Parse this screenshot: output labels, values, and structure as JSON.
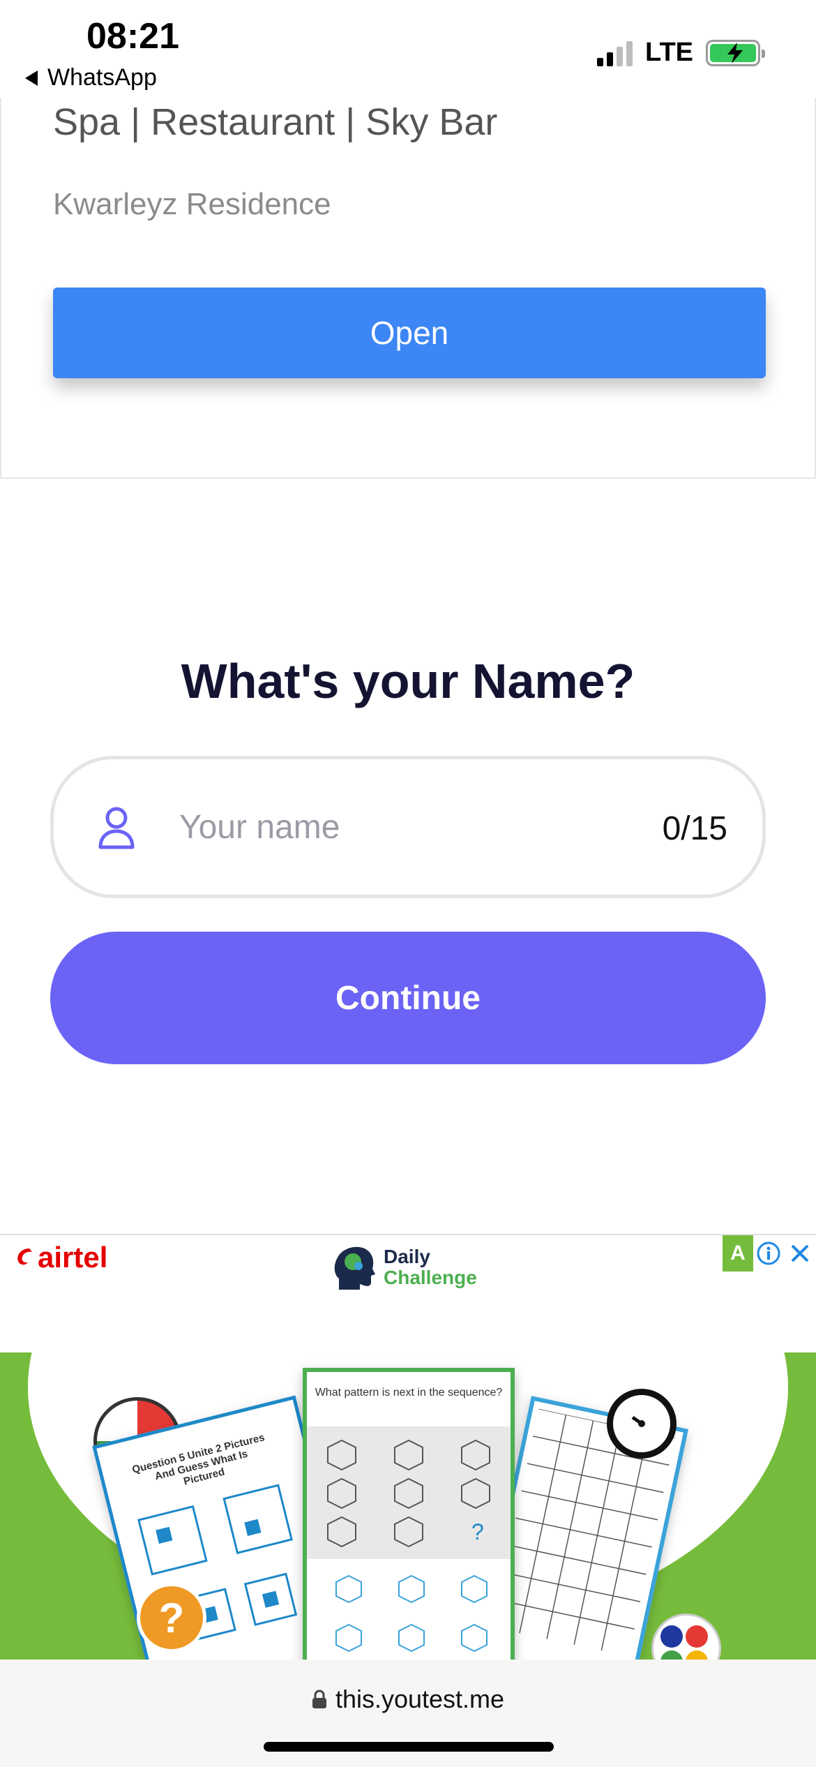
{
  "status_bar": {
    "time": "08:21",
    "back_app": "WhatsApp",
    "network": "LTE"
  },
  "top_card": {
    "title": "Spa | Restaurant | Sky Bar",
    "subtitle": "Kwarleyz Residence",
    "open_label": "Open"
  },
  "name_form": {
    "heading": "What's your Name?",
    "input_value": "",
    "input_placeholder": "Your name",
    "counter": "0/15",
    "continue_label": "Continue"
  },
  "ad": {
    "brand": "airtel",
    "headline_line1": "Daily",
    "headline_line2": "Challenge",
    "badge_letter": "A",
    "sheet_left_title": "Question 5 Unite 2 Pictures And Guess What Is Pictured",
    "sheet_center_title": "What pattern is next in the sequence?",
    "question_mark": "?"
  },
  "url_bar": {
    "url": "this.youtest.me"
  },
  "colors": {
    "open_button": "#3d86f5",
    "continue_button": "#6b63f6",
    "heading": "#141432",
    "ad_green": "#76bc3c"
  }
}
